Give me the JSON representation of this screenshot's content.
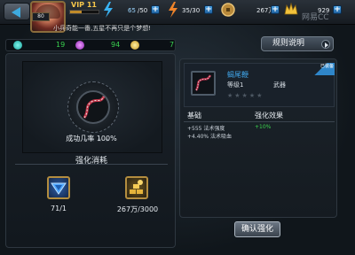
{
  "topbar": {
    "player_level": "80",
    "vip_label": "VIP 11",
    "stamina": "65",
    "stamina_max": "/50",
    "energy": "35/30",
    "coins": "267万",
    "diamonds": "929",
    "watermark": "网易CC"
  },
  "marquee": {
    "text": "小兵奇能一番,五星不再只是个梦想!"
  },
  "resources": [
    {
      "value": "19",
      "icon": "green-gem-icon",
      "color": "#3bd1c8"
    },
    {
      "value": "94",
      "icon": "purple-gem-icon",
      "color": "#c34fe0"
    },
    {
      "value": "7",
      "icon": "gold-gem-icon",
      "color": "#f1c33c"
    }
  ],
  "rules_button": {
    "label": "规则说明"
  },
  "left_panel": {
    "success_rate": "成功几率 100%",
    "consume_title": "强化消耗",
    "materials": [
      {
        "name": "shard",
        "count": "71/1"
      },
      {
        "name": "gold",
        "count": "267万/3000"
      }
    ]
  },
  "item": {
    "name": "蝎尾鞭",
    "level": "等级1",
    "type": "武器",
    "tag": "已装备"
  },
  "attributes": {
    "base_header": "基础",
    "enhance_header": "强化效果",
    "rows": [
      {
        "base": "+555 法术强度",
        "bonus": "+10%"
      },
      {
        "base": "+4.40% 法术吸血",
        "bonus": ""
      }
    ]
  },
  "confirm_button": {
    "label": "确认强化"
  },
  "colors": {
    "accent_blue": "#3fa3e6",
    "bonus_green": "#3bd64f",
    "vip_gold": "#f4c54a"
  }
}
